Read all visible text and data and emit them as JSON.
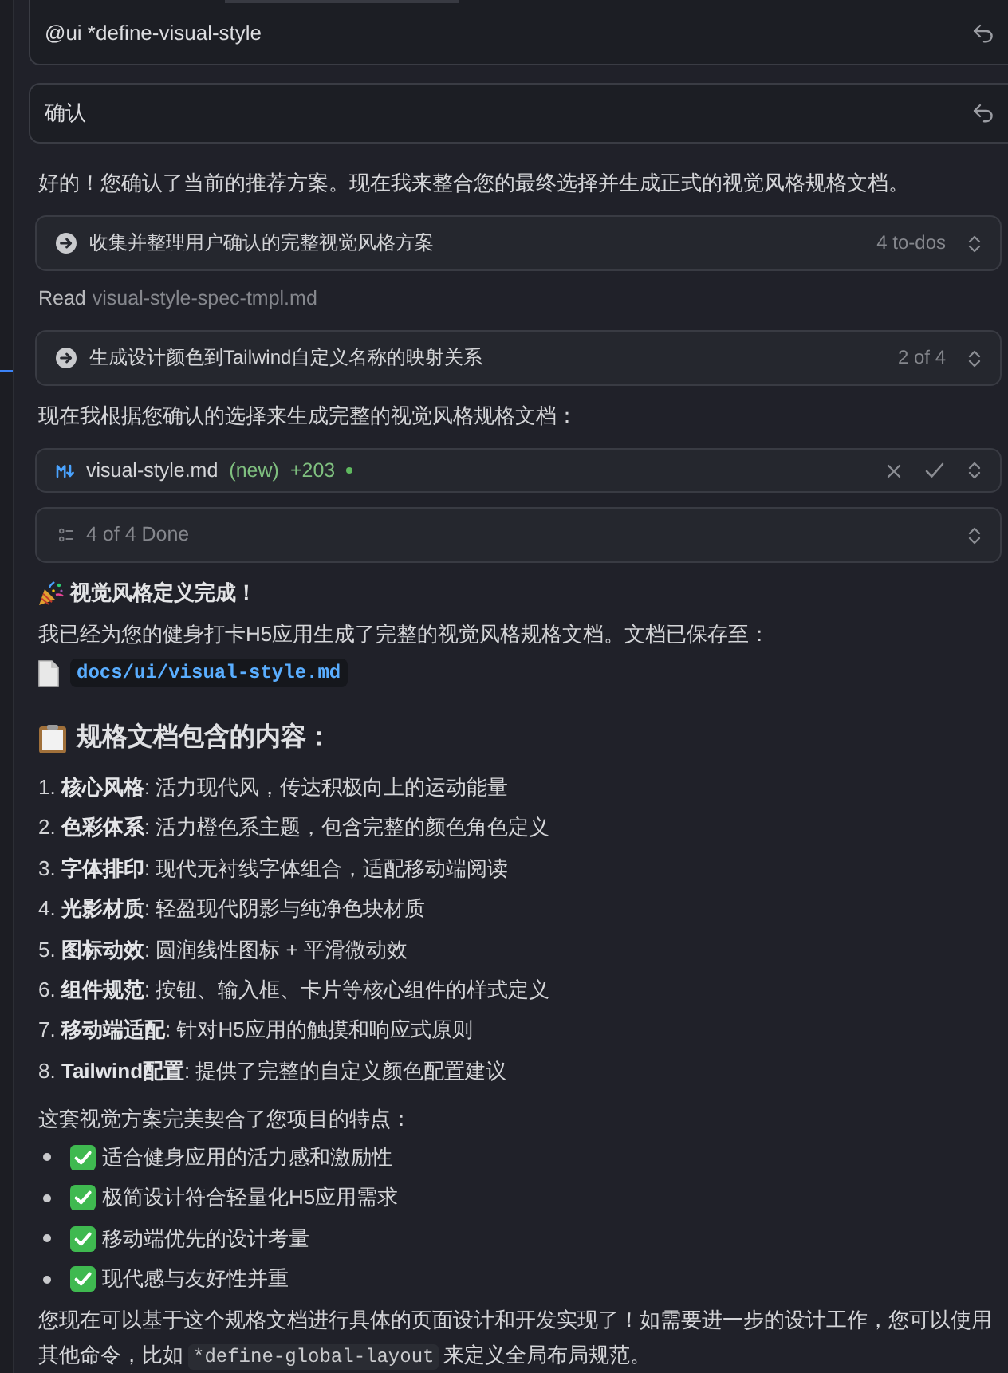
{
  "blocks": [
    {
      "kind": "prompt",
      "text": "@ui *define-visual-style"
    },
    {
      "kind": "prompt",
      "text": "确认"
    },
    {
      "kind": "paragraph",
      "text": "好的！您确认了当前的推荐方案。现在我来整合您的最终选择并生成正式的视觉风格规格文档。"
    },
    {
      "kind": "todo",
      "text": "收集并整理用户确认的完整视觉风格方案",
      "status": "4 to-dos"
    },
    {
      "kind": "read",
      "verb": "Read",
      "file": "visual-style-spec-tmpl.md"
    },
    {
      "kind": "todo",
      "text": "生成设计颜色到Tailwind自定义名称的映射关系",
      "status": "2 of 4"
    },
    {
      "kind": "paragraph",
      "text": "现在我根据您确认的选择来生成完整的视觉风格规格文档："
    },
    {
      "kind": "file_edit",
      "file": "visual-style.md",
      "tag": "(new)",
      "added": "+203"
    },
    {
      "kind": "todo_summary",
      "text": "4 of 4 Done"
    },
    {
      "kind": "title",
      "text": "视觉风格定义完成！"
    },
    {
      "kind": "paragraph",
      "text": "我已经为您的健身打卡H5应用生成了完整的视觉风格规格文档。文档已保存至："
    },
    {
      "kind": "file_path",
      "path": "docs/ui/visual-style.md"
    },
    {
      "kind": "heading",
      "text": "规格文档包含的内容："
    },
    {
      "kind": "ordered_list",
      "items": [
        "1. **核心风格**: 活力现代风，传达积极向上的运动能量",
        "2. **色彩体系**: 活力橙色系主题，包含完整的颜色角色定义",
        "3. **字体排印**: 现代无衬线字体组合，适配移动端阅读",
        "4. **光影材质**: 轻盈现代阴影与纯净色块材质",
        "5. **图标动效**: 圆润线性图标 + 平滑微动效",
        "6. **组件规范**: 按钮、输入框、卡片等核心组件的样式定义",
        "7. **移动端适配**: 针对H5应用的触摸和响应式原则",
        "8. **Tailwind配置**: 提供了完整的自定义颜色配置建议"
      ]
    },
    {
      "kind": "paragraph",
      "text": "这套视觉方案完美契合了您项目的特点："
    },
    {
      "kind": "checklist",
      "items": [
        {
          "text": "适合健身应用的活力感和激励性",
          "checked": true
        },
        {
          "text": "极简设计符合轻量化H5应用需求",
          "checked": true
        },
        {
          "text": "移动端优先的设计考量",
          "checked": true
        },
        {
          "text": "现代感与友好性并重",
          "checked": true
        }
      ]
    },
    {
      "kind": "paragraph",
      "parts": [
        {
          "kind": "text",
          "text": "您现在可以基于这个规格文档进行具体的页面设计和开发实现了！如需要进一步的设计工作，您可以使用其他命令，比如"
        },
        {
          "kind": "code",
          "text": "*define-global-layout"
        },
        {
          "kind": "text",
          "text": "来定义全局布局规范。"
        }
      ]
    }
  ]
}
